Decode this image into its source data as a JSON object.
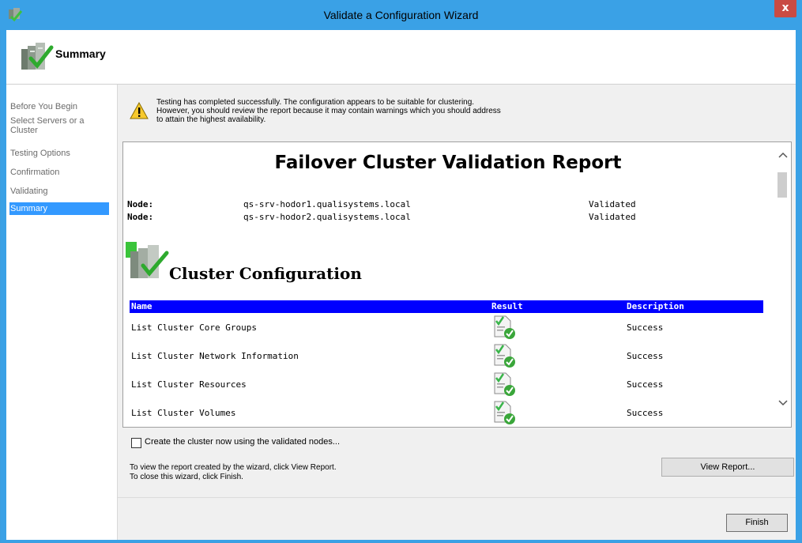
{
  "window": {
    "title": "Validate a Configuration Wizard",
    "close_glyph": "x",
    "app_icon": "cluster-wizard-icon"
  },
  "header": {
    "title": "Summary",
    "icon": "cluster-check-icon"
  },
  "nav": {
    "items": [
      {
        "label": "Before You Begin"
      },
      {
        "label": "Select Servers or a Cluster"
      },
      {
        "label": "Testing Options"
      },
      {
        "label": "Confirmation"
      },
      {
        "label": "Validating"
      },
      {
        "label": "Summary",
        "selected": true
      }
    ]
  },
  "warning": {
    "icon": "warning-icon",
    "line1": "Testing has completed successfully. The configuration appears to be suitable for clustering.",
    "line2": "However, you should review the report because it may contain warnings which you should address",
    "line3": "to attain the highest availability."
  },
  "report": {
    "title": "Failover Cluster Validation Report",
    "nodes": [
      {
        "label": "Node:",
        "name": "qs-srv-hodor1.qualisystems.local",
        "status": "Validated"
      },
      {
        "label": "Node:",
        "name": "qs-srv-hodor2.qualisystems.local",
        "status": "Validated"
      }
    ],
    "section_title": "Cluster Configuration",
    "table": {
      "columns": [
        "Name",
        "Result",
        "Description"
      ],
      "rows": [
        {
          "name": "List Cluster Core Groups",
          "description": "Success"
        },
        {
          "name": "List Cluster Network Information",
          "description": "Success"
        },
        {
          "name": "List Cluster Resources",
          "description": "Success"
        },
        {
          "name": "List Cluster Volumes",
          "description": "Success"
        }
      ]
    },
    "scroll_up": "^",
    "scroll_down": "v"
  },
  "create_cluster": {
    "label": "Create the cluster now using the validated nodes...",
    "checked": false
  },
  "info": {
    "line1": "To view the report created by the wizard, click View Report.",
    "line2": "To close this wizard, click Finish."
  },
  "buttons": {
    "view_report": "View Report...",
    "finish": "Finish"
  },
  "colors": {
    "title_bar": "#3aa1e6",
    "selected_nav": "#3399ff",
    "table_header": "#0000ff",
    "close_button": "#c94b44"
  }
}
